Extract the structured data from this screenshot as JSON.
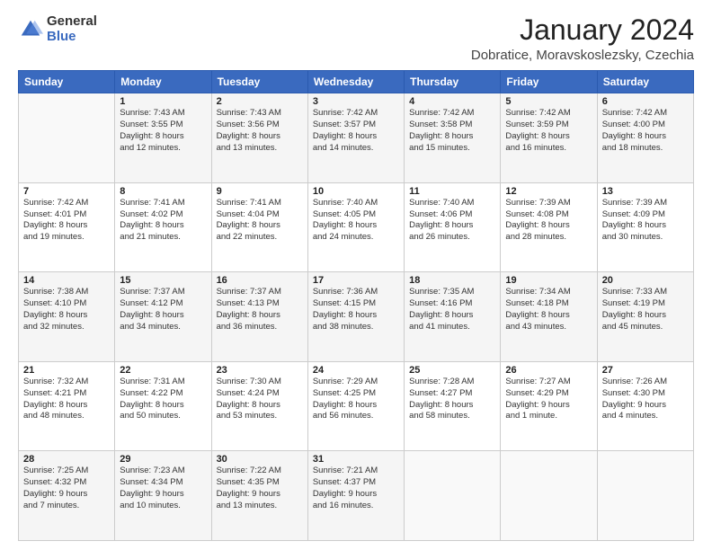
{
  "logo": {
    "general": "General",
    "blue": "Blue"
  },
  "title": "January 2024",
  "location": "Dobratice, Moravskoslezsky, Czechia",
  "weekdays": [
    "Sunday",
    "Monday",
    "Tuesday",
    "Wednesday",
    "Thursday",
    "Friday",
    "Saturday"
  ],
  "weeks": [
    [
      {
        "day": "",
        "info": ""
      },
      {
        "day": "1",
        "info": "Sunrise: 7:43 AM\nSunset: 3:55 PM\nDaylight: 8 hours\nand 12 minutes."
      },
      {
        "day": "2",
        "info": "Sunrise: 7:43 AM\nSunset: 3:56 PM\nDaylight: 8 hours\nand 13 minutes."
      },
      {
        "day": "3",
        "info": "Sunrise: 7:42 AM\nSunset: 3:57 PM\nDaylight: 8 hours\nand 14 minutes."
      },
      {
        "day": "4",
        "info": "Sunrise: 7:42 AM\nSunset: 3:58 PM\nDaylight: 8 hours\nand 15 minutes."
      },
      {
        "day": "5",
        "info": "Sunrise: 7:42 AM\nSunset: 3:59 PM\nDaylight: 8 hours\nand 16 minutes."
      },
      {
        "day": "6",
        "info": "Sunrise: 7:42 AM\nSunset: 4:00 PM\nDaylight: 8 hours\nand 18 minutes."
      }
    ],
    [
      {
        "day": "7",
        "info": "Sunrise: 7:42 AM\nSunset: 4:01 PM\nDaylight: 8 hours\nand 19 minutes."
      },
      {
        "day": "8",
        "info": "Sunrise: 7:41 AM\nSunset: 4:02 PM\nDaylight: 8 hours\nand 21 minutes."
      },
      {
        "day": "9",
        "info": "Sunrise: 7:41 AM\nSunset: 4:04 PM\nDaylight: 8 hours\nand 22 minutes."
      },
      {
        "day": "10",
        "info": "Sunrise: 7:40 AM\nSunset: 4:05 PM\nDaylight: 8 hours\nand 24 minutes."
      },
      {
        "day": "11",
        "info": "Sunrise: 7:40 AM\nSunset: 4:06 PM\nDaylight: 8 hours\nand 26 minutes."
      },
      {
        "day": "12",
        "info": "Sunrise: 7:39 AM\nSunset: 4:08 PM\nDaylight: 8 hours\nand 28 minutes."
      },
      {
        "day": "13",
        "info": "Sunrise: 7:39 AM\nSunset: 4:09 PM\nDaylight: 8 hours\nand 30 minutes."
      }
    ],
    [
      {
        "day": "14",
        "info": "Sunrise: 7:38 AM\nSunset: 4:10 PM\nDaylight: 8 hours\nand 32 minutes."
      },
      {
        "day": "15",
        "info": "Sunrise: 7:37 AM\nSunset: 4:12 PM\nDaylight: 8 hours\nand 34 minutes."
      },
      {
        "day": "16",
        "info": "Sunrise: 7:37 AM\nSunset: 4:13 PM\nDaylight: 8 hours\nand 36 minutes."
      },
      {
        "day": "17",
        "info": "Sunrise: 7:36 AM\nSunset: 4:15 PM\nDaylight: 8 hours\nand 38 minutes."
      },
      {
        "day": "18",
        "info": "Sunrise: 7:35 AM\nSunset: 4:16 PM\nDaylight: 8 hours\nand 41 minutes."
      },
      {
        "day": "19",
        "info": "Sunrise: 7:34 AM\nSunset: 4:18 PM\nDaylight: 8 hours\nand 43 minutes."
      },
      {
        "day": "20",
        "info": "Sunrise: 7:33 AM\nSunset: 4:19 PM\nDaylight: 8 hours\nand 45 minutes."
      }
    ],
    [
      {
        "day": "21",
        "info": "Sunrise: 7:32 AM\nSunset: 4:21 PM\nDaylight: 8 hours\nand 48 minutes."
      },
      {
        "day": "22",
        "info": "Sunrise: 7:31 AM\nSunset: 4:22 PM\nDaylight: 8 hours\nand 50 minutes."
      },
      {
        "day": "23",
        "info": "Sunrise: 7:30 AM\nSunset: 4:24 PM\nDaylight: 8 hours\nand 53 minutes."
      },
      {
        "day": "24",
        "info": "Sunrise: 7:29 AM\nSunset: 4:25 PM\nDaylight: 8 hours\nand 56 minutes."
      },
      {
        "day": "25",
        "info": "Sunrise: 7:28 AM\nSunset: 4:27 PM\nDaylight: 8 hours\nand 58 minutes."
      },
      {
        "day": "26",
        "info": "Sunrise: 7:27 AM\nSunset: 4:29 PM\nDaylight: 9 hours\nand 1 minute."
      },
      {
        "day": "27",
        "info": "Sunrise: 7:26 AM\nSunset: 4:30 PM\nDaylight: 9 hours\nand 4 minutes."
      }
    ],
    [
      {
        "day": "28",
        "info": "Sunrise: 7:25 AM\nSunset: 4:32 PM\nDaylight: 9 hours\nand 7 minutes."
      },
      {
        "day": "29",
        "info": "Sunrise: 7:23 AM\nSunset: 4:34 PM\nDaylight: 9 hours\nand 10 minutes."
      },
      {
        "day": "30",
        "info": "Sunrise: 7:22 AM\nSunset: 4:35 PM\nDaylight: 9 hours\nand 13 minutes."
      },
      {
        "day": "31",
        "info": "Sunrise: 7:21 AM\nSunset: 4:37 PM\nDaylight: 9 hours\nand 16 minutes."
      },
      {
        "day": "",
        "info": ""
      },
      {
        "day": "",
        "info": ""
      },
      {
        "day": "",
        "info": ""
      }
    ]
  ]
}
